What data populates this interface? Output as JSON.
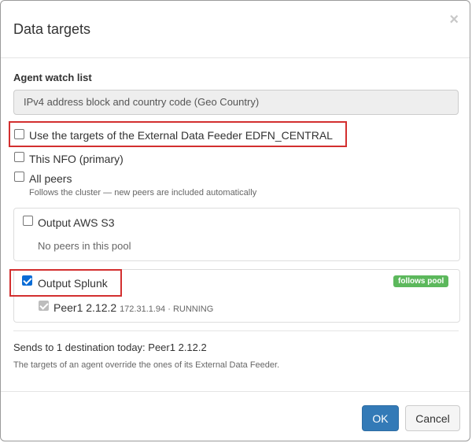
{
  "dialog": {
    "title": "Data targets",
    "close_glyph": "×"
  },
  "watch_list": {
    "label": "Agent watch list",
    "selected": "IPv4 address block and country code (Geo Country)"
  },
  "options": {
    "use_edf": {
      "label": "Use the targets of the External Data Feeder EDFN_CENTRAL",
      "checked": false
    },
    "this_nfo": {
      "label": "This NFO (primary)",
      "checked": false
    },
    "all_peers": {
      "label": "All peers",
      "checked": false,
      "help": "Follows the cluster — new peers are included automatically"
    }
  },
  "pools": {
    "aws": {
      "label": "Output AWS S3",
      "checked": false,
      "empty_text": "No peers in this pool"
    },
    "splunk": {
      "label": "Output Splunk",
      "checked": true,
      "badge": "follows pool",
      "peer": {
        "name": "Peer1 2.12.2",
        "meta": "172.31.1.94 · RUNNING",
        "checked": true
      }
    }
  },
  "summary": "Sends to 1 destination today: Peer1 2.12.2",
  "note": "The targets of an agent override the ones of its External Data Feeder.",
  "buttons": {
    "ok": "OK",
    "cancel": "Cancel"
  },
  "colors": {
    "primary": "#337ab7",
    "success": "#5cb85c",
    "highlight": "#d32f2f",
    "checkbox": "#0a6cd6"
  }
}
